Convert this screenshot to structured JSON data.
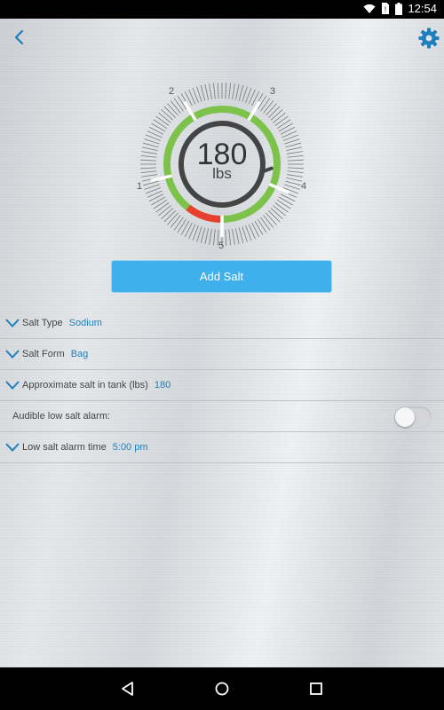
{
  "status_bar": {
    "time": "12:54",
    "icons": [
      "wifi-icon",
      "no-sim-icon",
      "battery-icon"
    ]
  },
  "header": {
    "back_icon": "chevron-left-icon",
    "settings_icon": "gear-icon"
  },
  "gauge": {
    "value": "180",
    "unit": "lbs",
    "scale_labels": [
      "1",
      "2",
      "3",
      "4",
      "5"
    ],
    "fill_fraction": 0.78,
    "colors": {
      "good": "#7dc24b",
      "low": "#e8402f",
      "needle": "#444444",
      "ticks": "#777777"
    }
  },
  "actions": {
    "add_salt_label": "Add Salt"
  },
  "settings": [
    {
      "label": "Salt Type",
      "value": "Sodium"
    },
    {
      "label": "Salt Form",
      "value": "Bag"
    },
    {
      "label": "Approximate salt in tank (lbs)",
      "value": "180"
    },
    {
      "label": "Audible low salt alarm:",
      "toggle": false
    },
    {
      "label": "Low salt alarm time",
      "value": "5:00 pm"
    }
  ],
  "nav_bar": {
    "icons": [
      "back-triangle-icon",
      "home-circle-icon",
      "recents-square-icon"
    ]
  },
  "theme": {
    "accent": "#1e7fbd",
    "button": "#3fb0ec"
  }
}
